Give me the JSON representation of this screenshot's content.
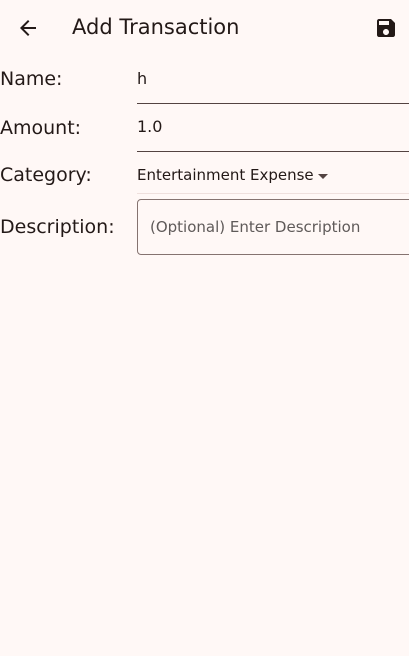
{
  "app_bar": {
    "title": "Add Transaction",
    "back_icon": "arrow-left-icon",
    "save_icon": "floppy-disk-icon"
  },
  "form": {
    "name": {
      "label": "Name:",
      "value": "h"
    },
    "amount": {
      "label": "Amount:",
      "value": "1.0"
    },
    "category": {
      "label": "Category:",
      "value": "Entertainment Expense",
      "caret_icon": "dropdown-caret-icon"
    },
    "description": {
      "label": "Description:",
      "placeholder": "(Optional) Enter Description"
    }
  },
  "colors": {
    "background": "#fff8f6",
    "text": "#231917",
    "outline": "#857370",
    "underline": "#534341"
  }
}
